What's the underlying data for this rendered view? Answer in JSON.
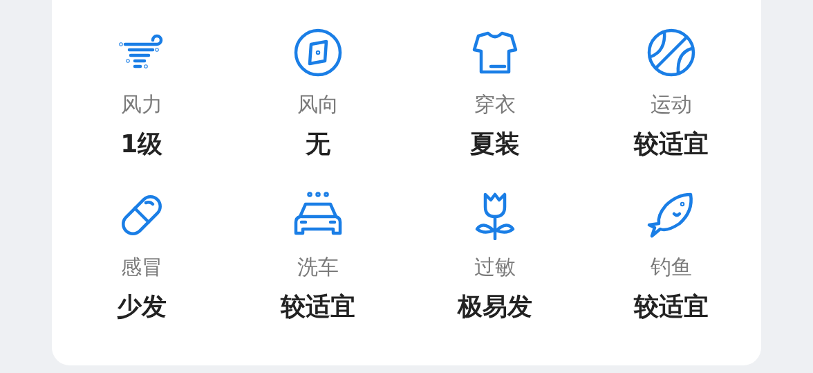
{
  "indices": [
    {
      "label": "风力",
      "value": "1级"
    },
    {
      "label": "风向",
      "value": "无"
    },
    {
      "label": "穿衣",
      "value": "夏装"
    },
    {
      "label": "运动",
      "value": "较适宜"
    },
    {
      "label": "感冒",
      "value": "少发"
    },
    {
      "label": "洗车",
      "value": "较适宜"
    },
    {
      "label": "过敏",
      "value": "极易发"
    },
    {
      "label": "钓鱼",
      "value": "较适宜"
    }
  ]
}
